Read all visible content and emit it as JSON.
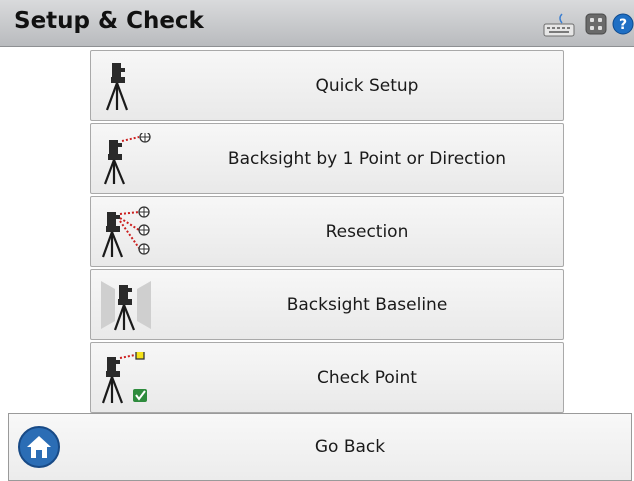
{
  "window": {
    "title": "Setup & Check"
  },
  "toolbar": {
    "keyboard_icon": "keyboard-icon",
    "panel_icon": "grid-panel-icon",
    "help_icon": "help-icon",
    "help_glyph": "?"
  },
  "menu": {
    "items": [
      {
        "label": "Quick Setup",
        "icon": "tripod-icon"
      },
      {
        "label": "Backsight by 1 Point or Direction",
        "icon": "backsight-point-icon"
      },
      {
        "label": "Resection",
        "icon": "resection-icon"
      },
      {
        "label": "Backsight Baseline",
        "icon": "backsight-baseline-icon"
      },
      {
        "label": "Check Point",
        "icon": "check-point-icon"
      }
    ]
  },
  "footer": {
    "back_label": "Go Back",
    "icon": "home-icon"
  },
  "colors": {
    "accent_red": "#cc1f1f",
    "help_blue": "#1f6fc4",
    "check_green": "#2e8b3d",
    "home_blue": "#2b6db5"
  }
}
